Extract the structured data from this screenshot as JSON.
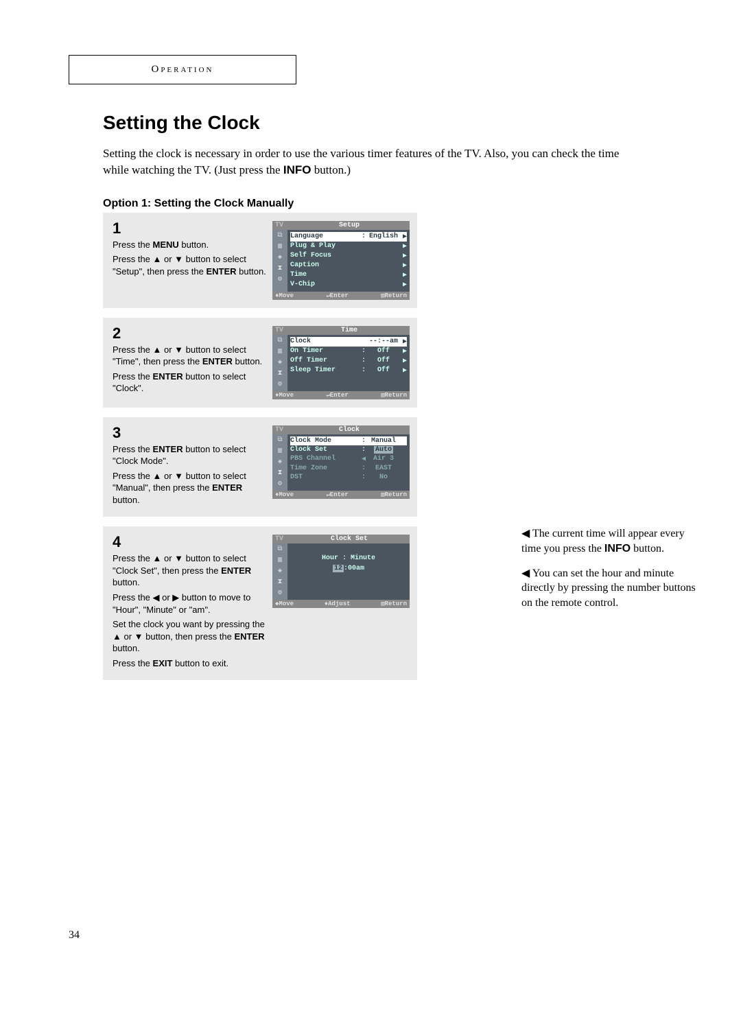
{
  "header": "Operation",
  "title": "Setting the Clock",
  "intro_a": "Setting the clock is necessary in order to use the various timer features of the TV. Also, you can check the time while watching the TV. (Just press the ",
  "intro_b_bold": "INFO",
  "intro_c": " button.)",
  "option_title": "Option 1: Setting the Clock Manually",
  "steps": {
    "s1": {
      "num": "1",
      "l1a": "Press the ",
      "l1b": "MENU",
      "l1c": " button.",
      "l2a": "Press the ▲ or ▼ button to select \"Setup\", then press the ",
      "l2b": "ENTER",
      "l2c": " button."
    },
    "s2": {
      "num": "2",
      "l1a": "Press the ▲ or ▼ button to select \"Time\", then press the ",
      "l1b": "ENTER",
      "l1c": " button.",
      "l2a": "Press the ",
      "l2b": "ENTER",
      "l2c": " button to select \"Clock\"."
    },
    "s3": {
      "num": "3",
      "l1a": "Press the ",
      "l1b": "ENTER",
      "l1c": " button to select \"Clock Mode\".",
      "l2a": "Press the ▲ or ▼ button to select \"Manual\", then press the ",
      "l2b": "ENTER",
      "l2c": " button."
    },
    "s4": {
      "num": "4",
      "l1a": "Press the ▲ or ▼ button to select \"Clock Set\", then press the ",
      "l1b": "ENTER",
      "l1c": " button.",
      "l2": "Press the ◀ or ▶ button to move to \"Hour\", \"Minute\" or \"am\".",
      "l3a": "Set the clock you want by pressing the ▲ or ▼ button, then press the ",
      "l3b": "ENTER",
      "l3c": " button.",
      "l4a": "Press the ",
      "l4b": "EXIT",
      "l4c": " button to exit."
    }
  },
  "osd1": {
    "tv": "TV",
    "title": "Setup",
    "rows": [
      {
        "lbl": "Language",
        "sep": ":",
        "val": "English",
        "arw": "▶",
        "hl": true
      },
      {
        "lbl": "Plug & Play",
        "sep": "",
        "val": "",
        "arw": "▶"
      },
      {
        "lbl": "Self Focus",
        "sep": "",
        "val": "",
        "arw": "▶"
      },
      {
        "lbl": "Caption",
        "sep": "",
        "val": "",
        "arw": "▶"
      },
      {
        "lbl": "Time",
        "sep": "",
        "val": "",
        "arw": "▶"
      },
      {
        "lbl": "V-Chip",
        "sep": "",
        "val": "",
        "arw": "▶"
      }
    ],
    "foot": {
      "a": "♦Move",
      "b": "↵Enter",
      "c": "▥Return"
    }
  },
  "osd2": {
    "tv": "TV",
    "title": "Time",
    "rows": [
      {
        "lbl": "Clock",
        "sep": "",
        "val": "--:--am",
        "arw": "▶",
        "hl": true
      },
      {
        "lbl": "On Timer",
        "sep": ":",
        "val": "Off",
        "arw": "▶"
      },
      {
        "lbl": "Off Timer",
        "sep": ":",
        "val": "Off",
        "arw": "▶"
      },
      {
        "lbl": "Sleep Timer",
        "sep": ":",
        "val": "Off",
        "arw": "▶"
      }
    ],
    "foot": {
      "a": "♦Move",
      "b": "↵Enter",
      "c": "▥Return"
    }
  },
  "osd3": {
    "tv": "TV",
    "title": "Clock",
    "rows": [
      {
        "lbl": "Clock Mode",
        "sep": ":",
        "val": "Manual",
        "arw": "",
        "hl": true
      },
      {
        "lbl": "Clock Set",
        "sep": ":",
        "val": "Auto",
        "arw": "",
        "valhl": true
      },
      {
        "lbl": "PBS Channel",
        "sep": "◀",
        "val": "Air  3",
        "arw": "",
        "dim": true
      },
      {
        "lbl": "Time Zone",
        "sep": ":",
        "val": "EAST",
        "arw": "",
        "dim": true
      },
      {
        "lbl": "DST",
        "sep": ":",
        "val": "No",
        "arw": "",
        "dim": true
      }
    ],
    "foot": {
      "a": "♦Move",
      "b": "↵Enter",
      "c": "▥Return"
    }
  },
  "osd4": {
    "tv": "TV",
    "title": "Clock Set",
    "hm": "Hour : Minute",
    "h": "12",
    "rest": ":00am",
    "foot": {
      "a": "◆Move",
      "b": "♦Adjust",
      "c": "▥Return"
    }
  },
  "notes": {
    "n1a": "◀ The current time will appear every time you press the ",
    "n1b": "INFO",
    "n1c": " button.",
    "n2": "◀ You can set the hour and minute directly by pressing the number buttons on the remote control."
  },
  "pagenum": "34"
}
